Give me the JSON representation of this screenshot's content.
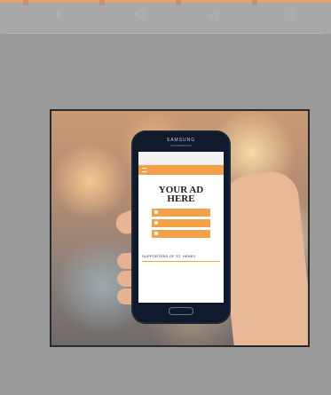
{
  "phone": {
    "brand": "SAMSUNG",
    "status_left": "",
    "status_time": "",
    "url": "",
    "app_title": "",
    "ad": {
      "title_line1": "YOUR AD",
      "title_line2": "HERE",
      "subtitle": "",
      "buttons": [
        "",
        "",
        ""
      ]
    },
    "section_title": "SUPPORTERS OF ST. HENRY",
    "sponsor_link": "",
    "sponsor_name": ""
  },
  "colors": {
    "accent": "#f2a14a",
    "background": "#9a9a9a",
    "phone_body": "#0f1b2c"
  }
}
